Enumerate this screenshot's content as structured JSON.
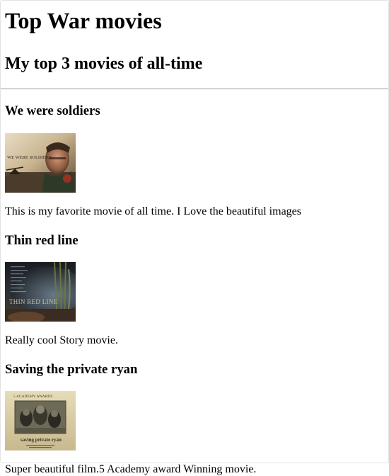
{
  "page": {
    "title": "Top War movies",
    "subtitle": "My top 3 movies of all-time"
  },
  "movies": [
    {
      "title": "We were soldiers",
      "description": "This is my favorite movie of all time. I Love the beautiful images",
      "poster_text": "WE WERE SOLDIERS"
    },
    {
      "title": "Thin red line",
      "description": "Really cool Story movie.",
      "poster_text": "THIN RED LINE"
    },
    {
      "title": "Saving the private ryan",
      "description": "Super beautiful film.5 Academy award Winning movie.",
      "poster_text_top": "5 ACADEMY AWARDS",
      "poster_text_bottom": "saving private ryan"
    }
  ]
}
